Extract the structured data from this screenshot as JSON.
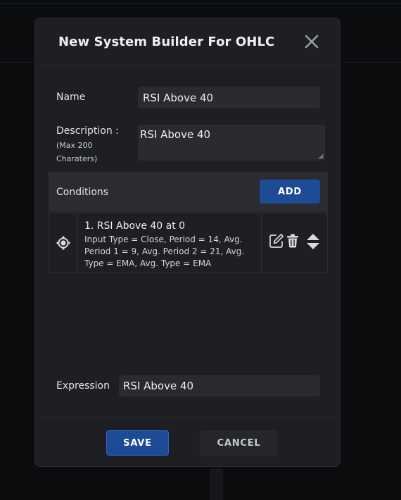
{
  "dialog": {
    "title": "New System Builder For OHLC",
    "close_icon": "close-icon"
  },
  "form": {
    "name_label": "Name",
    "name_value": "RSI Above 40",
    "description_label": "Description :",
    "description_hint_line1": "(Max 200",
    "description_hint_line2": "Charaters)",
    "description_value": "RSI Above 40"
  },
  "conditions": {
    "title": "Conditions",
    "add_label": "ADD",
    "items": [
      {
        "icon": "drag-handle-icon",
        "name": "1. RSI Above 40 at 0",
        "details": "Input Type = Close, Period = 14, Avg. Period 1 = 9, Avg. Period 2 = 21, Avg. Type = EMA, Avg. Type = EMA",
        "actions": [
          "edit-icon",
          "trash-icon",
          "sort-arrows-icon"
        ]
      }
    ]
  },
  "expression": {
    "label": "Expression",
    "value": "RSI Above 40"
  },
  "footer": {
    "save_label": "SAVE",
    "cancel_label": "CANCEL"
  },
  "colors": {
    "primary": "#1d4b96",
    "surface": "#1e1f23",
    "input_bg": "#2a2b30",
    "page_bg": "#0b0c0e"
  }
}
